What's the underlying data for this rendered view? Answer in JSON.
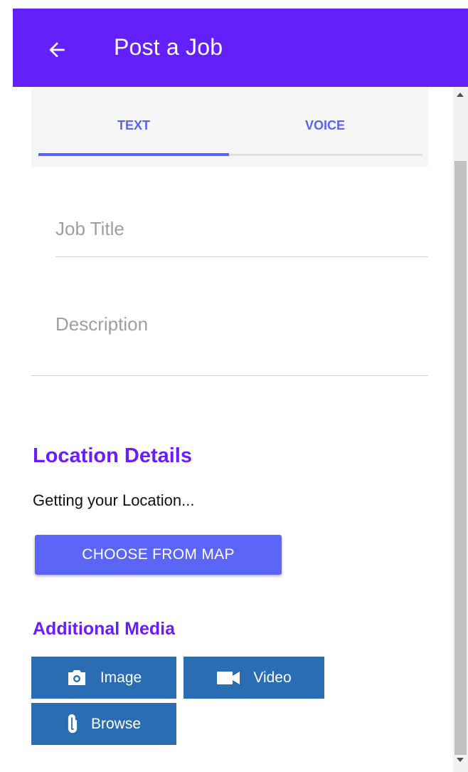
{
  "appbar": {
    "title": "Post a Job",
    "back_icon": "arrow-left-icon",
    "color": "#6420fb"
  },
  "tabs": [
    {
      "label": "TEXT",
      "active": true
    },
    {
      "label": "VOICE",
      "active": false
    }
  ],
  "form": {
    "job_title_placeholder": "Job Title",
    "description_placeholder": "Description"
  },
  "location": {
    "heading": "Location Details",
    "status": "Getting your Location...",
    "choose_button": "CHOOSE FROM MAP"
  },
  "media": {
    "heading": "Additional Media",
    "buttons": [
      {
        "label": "Image",
        "icon": "camera-icon"
      },
      {
        "label": "Video",
        "icon": "videocam-icon"
      },
      {
        "label": "Browse",
        "icon": "paperclip-icon"
      }
    ]
  },
  "colors": {
    "accent": "#5b66f6",
    "heading": "#6a1cff",
    "media_button": "#2a6db3"
  }
}
